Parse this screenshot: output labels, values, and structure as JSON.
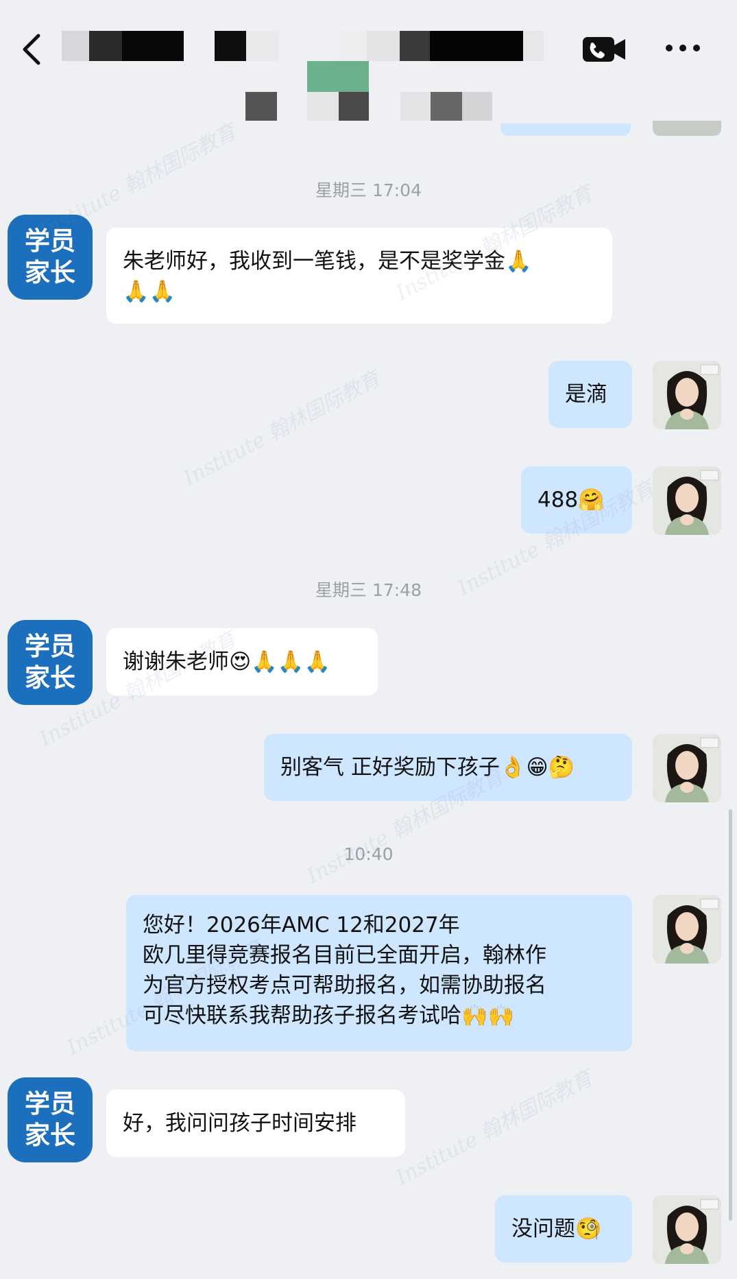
{
  "header": {
    "back_icon": "chevron-left-icon",
    "call_icon": "phone-video-icon",
    "more_icon": "more-dots-icon"
  },
  "badge": {
    "line1": "学员",
    "line2": "家长"
  },
  "watermark_text": "Institute 翰林国际教育",
  "messages": [
    {
      "kind": "timestamp",
      "text": "星期三 17:04"
    },
    {
      "kind": "incoming",
      "line1": "朱老师好，我收到一笔钱，是不是奖学金🙏",
      "line2": "🙏🙏"
    },
    {
      "kind": "outgoing",
      "text": "是滴"
    },
    {
      "kind": "outgoing",
      "text": "488🤗"
    },
    {
      "kind": "timestamp",
      "text": "星期三 17:48"
    },
    {
      "kind": "incoming",
      "text": "谢谢朱老师😍🙏🙏🙏"
    },
    {
      "kind": "outgoing",
      "text": "别客气 正好奖励下孩子👌😁🤔"
    },
    {
      "kind": "timestamp",
      "text": "10:40"
    },
    {
      "kind": "outgoing",
      "lines": [
        "您好！2026年AMC 12和2027年",
        "欧几里得竞赛报名目前已全面开启，翰林作",
        "为官方授权考点可帮助报名，如需协助报名",
        "可尽快联系我帮助孩子报名考试哈🙌🙌"
      ]
    },
    {
      "kind": "incoming",
      "text": "好，我问问孩子时间安排"
    },
    {
      "kind": "outgoing",
      "text": "没问题🧐"
    }
  ],
  "colors": {
    "background": "#eef0f4",
    "outgoing_bubble": "#cfe6ff",
    "incoming_bubble": "#ffffff",
    "badge": "#1c6fbd",
    "timestamp": "#9aa0a6"
  }
}
